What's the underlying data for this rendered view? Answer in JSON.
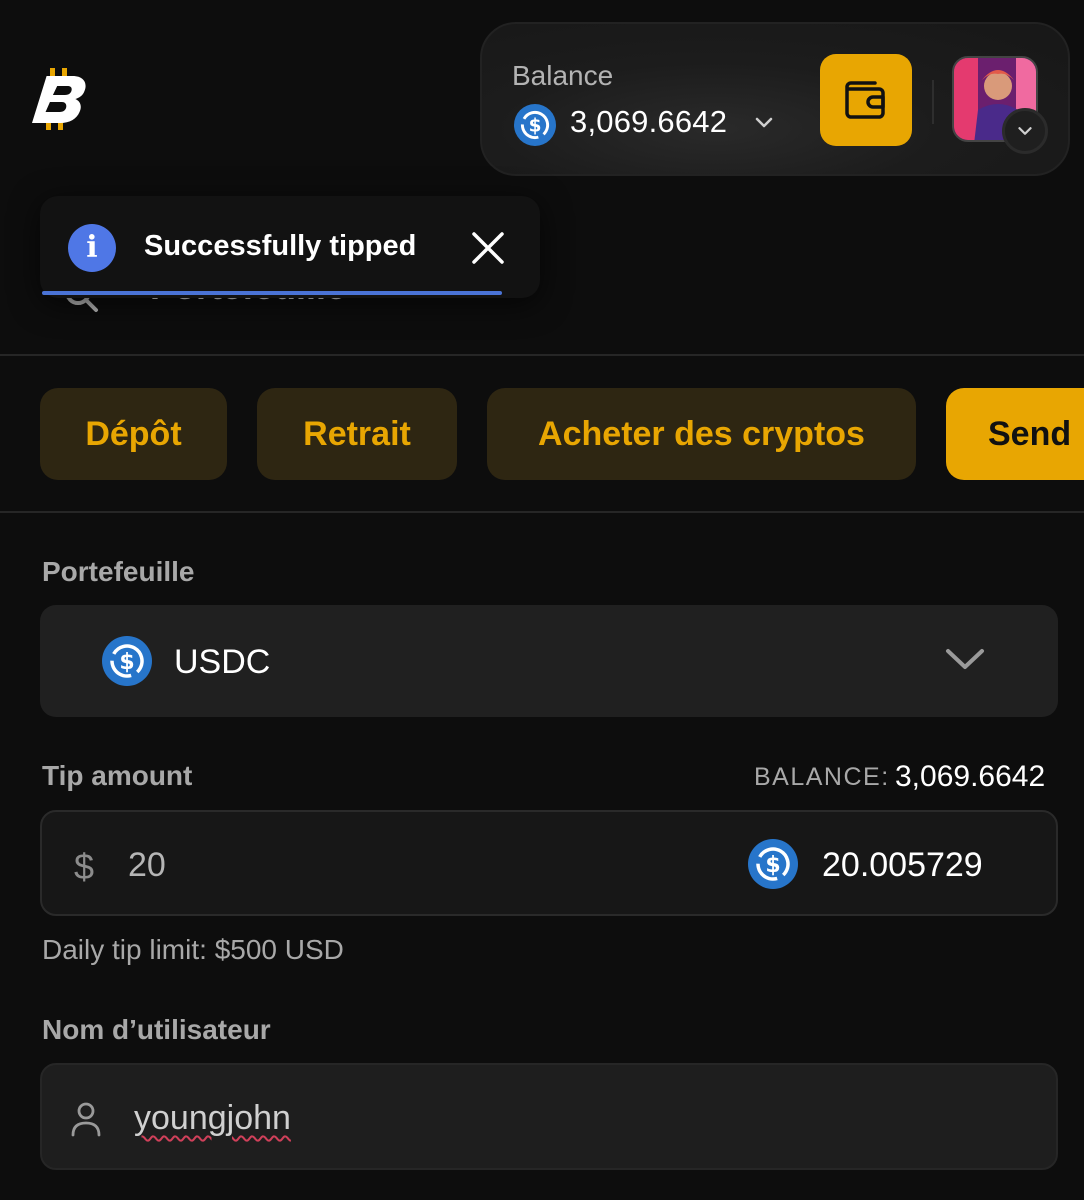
{
  "header": {
    "balance_label": "Balance",
    "balance_amount": "3,069.6642",
    "coin_icon": "usdc-icon",
    "brand_color": "#e8a602"
  },
  "toast": {
    "message": "Successfully tipped",
    "behind_title": "Portefeuille",
    "accent_color": "#4a73d6"
  },
  "actions": [
    {
      "label": "Dépôt"
    },
    {
      "label": "Retrait"
    },
    {
      "label": "Acheter des cryptos"
    },
    {
      "label": "Send"
    }
  ],
  "form": {
    "wallet_label": "Portefeuille",
    "wallet_value": "USDC",
    "tip_label": "Tip amount",
    "balance_label": "BALANCE:",
    "balance_value": "3,069.6642",
    "currency_symbol": "$",
    "usd_amount": "20",
    "crypto_amount": "20.005729",
    "daily_limit": "Daily tip limit: $500 USD",
    "username_label": "Nom d’utilisateur",
    "username_value": "youngjohn"
  }
}
